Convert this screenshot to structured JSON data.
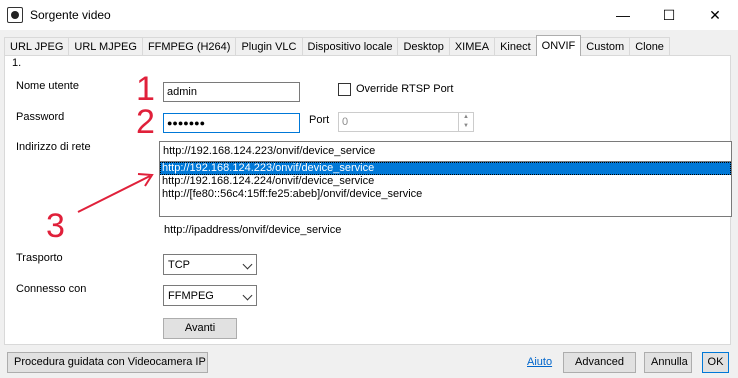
{
  "window": {
    "title": "Sorgente video",
    "minimize_glyph": "—",
    "maximize_glyph": "☐",
    "close_glyph": "✕"
  },
  "tabs": [
    {
      "label": "URL JPEG"
    },
    {
      "label": "URL MJPEG"
    },
    {
      "label": "FFMPEG (H264)"
    },
    {
      "label": "Plugin VLC"
    },
    {
      "label": "Dispositivo locale"
    },
    {
      "label": "Desktop"
    },
    {
      "label": "XIMEA"
    },
    {
      "label": "Kinect"
    },
    {
      "label": "ONVIF",
      "active": true
    },
    {
      "label": "Custom"
    },
    {
      "label": "Clone"
    }
  ],
  "form": {
    "step_label": "1.",
    "username_label": "Nome utente",
    "username_value": "admin",
    "override_rtsp_label": "Override RTSP Port",
    "password_label": "Password",
    "password_value": "●●●●●●●",
    "port_label": "Port",
    "port_value": "0",
    "network_address_label": "Indirizzo di rete",
    "network_address_value": "http://192.168.124.223/onvif/device_service",
    "address_options": [
      "http://192.168.124.223/onvif/device_service",
      "http://192.168.124.224/onvif/device_service",
      "http://[fe80::56c4:15ff:fe25:abeb]/onvif/device_service"
    ],
    "address_hint": "http://ipaddress/onvif/device_service",
    "transport_label": "Trasporto",
    "transport_value": "TCP",
    "connected_with_label": "Connesso con",
    "connected_with_value": "FFMPEG",
    "next_button": "Avanti"
  },
  "footer": {
    "wizard_button": "Procedura guidata con Videocamera IP",
    "help_link": "Aiuto",
    "advanced_button": "Advanced",
    "cancel_button": "Annulla",
    "ok_button": "OK"
  },
  "annotations": {
    "n1": "1",
    "n2": "2",
    "n3": "3",
    "color": "#e0203a"
  }
}
